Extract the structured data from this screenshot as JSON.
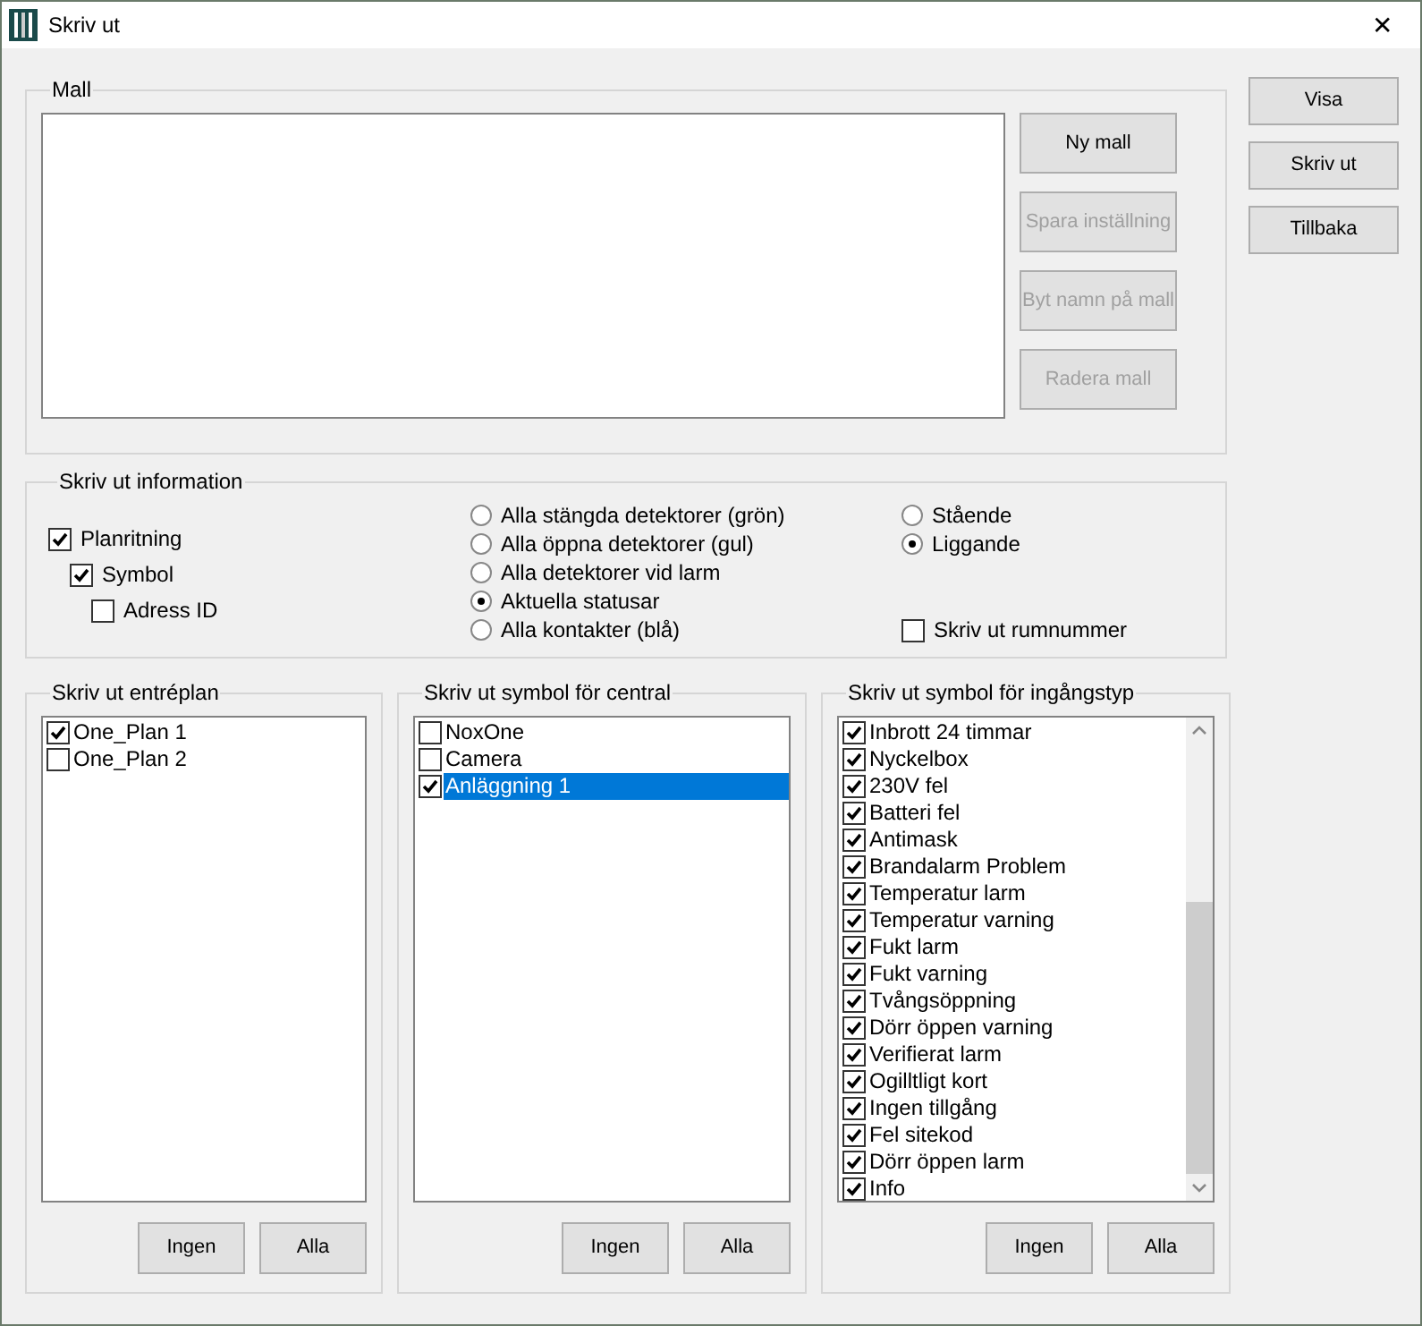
{
  "window": {
    "title": "Skriv ut",
    "close": "✕"
  },
  "mall": {
    "label": "Mall",
    "buttons": [
      {
        "label": "Ny mall",
        "disabled": false
      },
      {
        "label": "Spara inställning",
        "disabled": true
      },
      {
        "label": "Byt namn på mall",
        "disabled": true
      },
      {
        "label": "Radera mall",
        "disabled": true
      }
    ]
  },
  "side_buttons": [
    "Visa",
    "Skriv ut",
    "Tillbaka"
  ],
  "info": {
    "label": "Skriv ut information",
    "checkboxes": [
      {
        "label": "Planritning",
        "checked": true,
        "children": [
          {
            "label": "Symbol",
            "checked": true,
            "children": [
              {
                "label": "Adress ID",
                "checked": false
              }
            ]
          }
        ]
      }
    ],
    "detector_radios": [
      {
        "label": "Alla stängda detektorer (grön)",
        "selected": false
      },
      {
        "label": "Alla öppna detektorer (gul)",
        "selected": false
      },
      {
        "label": "Alla detektorer vid larm",
        "selected": false
      },
      {
        "label": "Aktuella statusar",
        "selected": true
      },
      {
        "label": "Alla kontakter (blå)",
        "selected": false
      }
    ],
    "orientation_radios": [
      {
        "label": "Stående",
        "selected": false
      },
      {
        "label": "Liggande",
        "selected": true
      }
    ],
    "room_number": {
      "label": "Skriv ut rumnummer",
      "checked": false
    }
  },
  "lists": [
    {
      "label": "Skriv ut entréplan",
      "scrollable": false,
      "buttons": [
        "Ingen",
        "Alla"
      ],
      "items": [
        {
          "label": "One_Plan 1",
          "checked": true,
          "selected": false
        },
        {
          "label": "One_Plan 2",
          "checked": false,
          "selected": false
        }
      ]
    },
    {
      "label": "Skriv ut symbol för central",
      "scrollable": false,
      "buttons": [
        "Ingen",
        "Alla"
      ],
      "items": [
        {
          "label": "NoxOne",
          "checked": false,
          "selected": false
        },
        {
          "label": "Camera",
          "checked": false,
          "selected": false
        },
        {
          "label": "Anläggning 1",
          "checked": true,
          "selected": true
        }
      ]
    },
    {
      "label": "Skriv ut symbol för ingångstyp",
      "scrollable": true,
      "buttons": [
        "Ingen",
        "Alla"
      ],
      "items": [
        {
          "label": "Inbrott 24 timmar",
          "checked": true,
          "selected": false
        },
        {
          "label": "Nyckelbox",
          "checked": true,
          "selected": false
        },
        {
          "label": "230V fel",
          "checked": true,
          "selected": false
        },
        {
          "label": "Batteri fel",
          "checked": true,
          "selected": false
        },
        {
          "label": "Antimask",
          "checked": true,
          "selected": false
        },
        {
          "label": "Brandalarm Problem",
          "checked": true,
          "selected": false
        },
        {
          "label": "Temperatur larm",
          "checked": true,
          "selected": false
        },
        {
          "label": "Temperatur varning",
          "checked": true,
          "selected": false
        },
        {
          "label": "Fukt larm",
          "checked": true,
          "selected": false
        },
        {
          "label": "Fukt varning",
          "checked": true,
          "selected": false
        },
        {
          "label": "Tvångsöppning",
          "checked": true,
          "selected": false
        },
        {
          "label": "Dörr öppen varning",
          "checked": true,
          "selected": false
        },
        {
          "label": "Verifierat larm",
          "checked": true,
          "selected": false
        },
        {
          "label": "Ogilltligt kort",
          "checked": true,
          "selected": false
        },
        {
          "label": "Ingen tillgång",
          "checked": true,
          "selected": false
        },
        {
          "label": "Fel sitekod",
          "checked": true,
          "selected": false
        },
        {
          "label": "Dörr öppen larm",
          "checked": true,
          "selected": false
        },
        {
          "label": "Info",
          "checked": true,
          "selected": false
        }
      ]
    }
  ]
}
